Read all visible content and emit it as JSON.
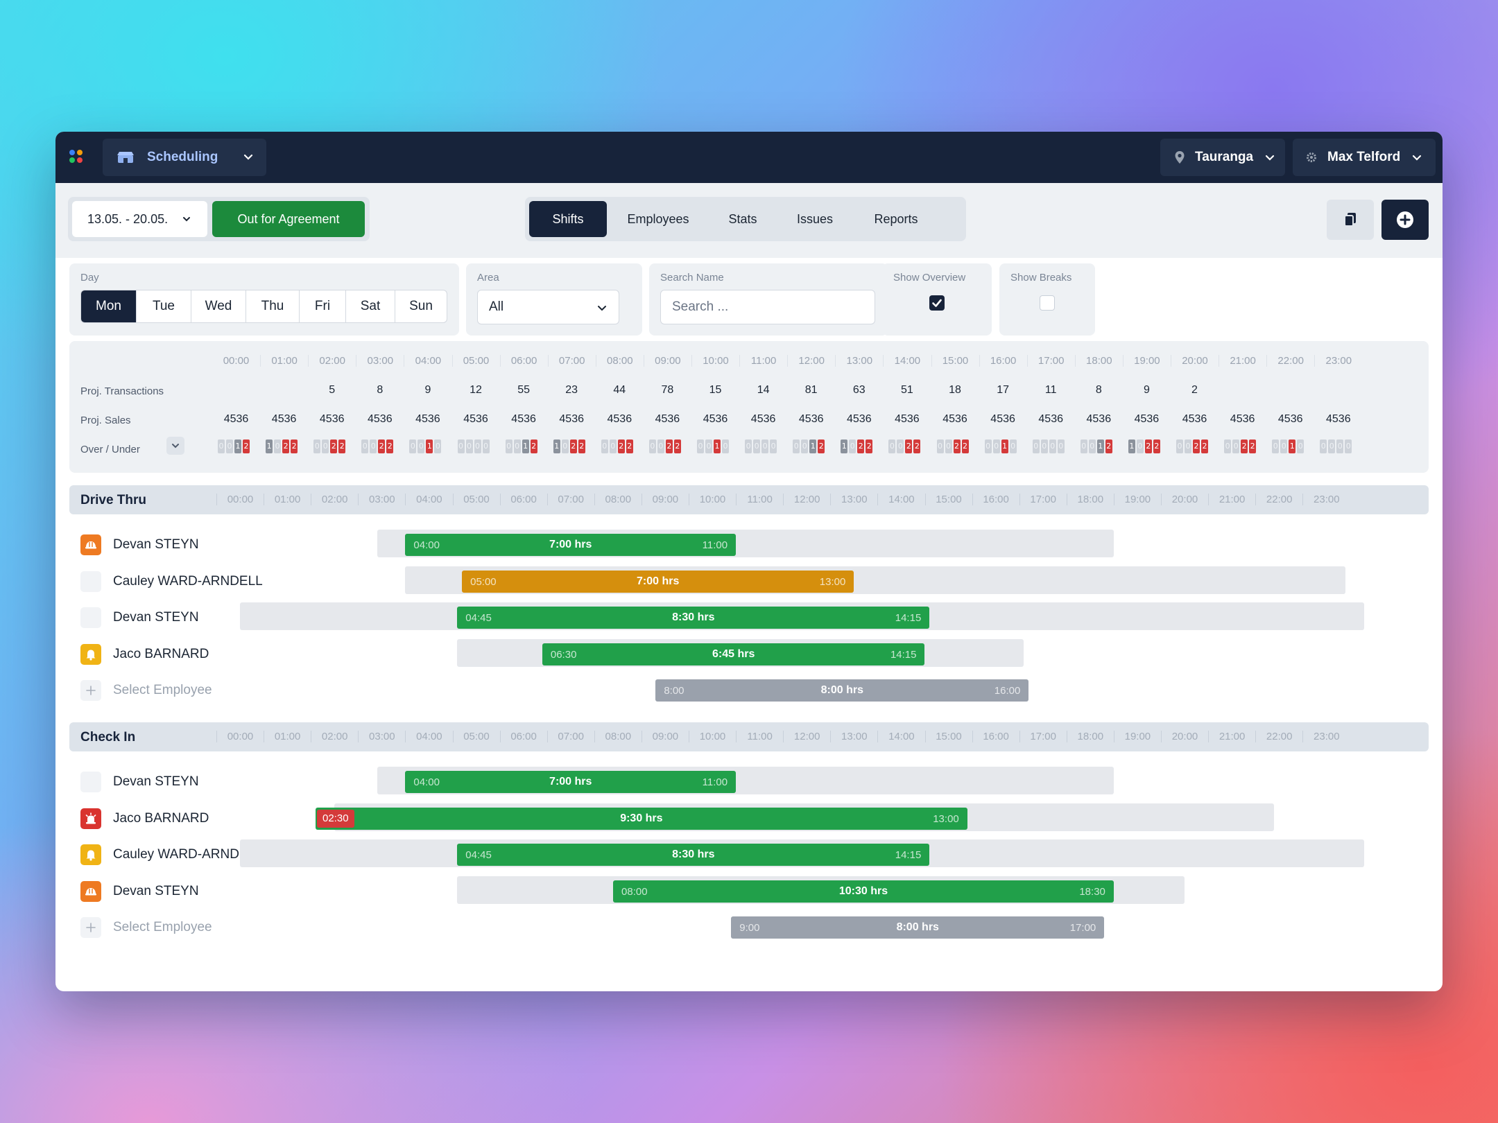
{
  "header": {
    "app_name": "Scheduling",
    "location": "Tauranga",
    "user": "Max Telford"
  },
  "toolbar": {
    "date_range": "13.05. - 20.05.",
    "status_button": "Out for Agreement",
    "tabs": [
      "Shifts",
      "Employees",
      "Stats",
      "Issues",
      "Reports"
    ],
    "active_tab": "Shifts"
  },
  "filters": {
    "day_label": "Day",
    "days": [
      "Mon",
      "Tue",
      "Wed",
      "Thu",
      "Fri",
      "Sat",
      "Sun"
    ],
    "active_day": "Mon",
    "area_label": "Area",
    "area_value": "All",
    "search_label": "Search Name",
    "search_placeholder": "Search ...",
    "overview_label": "Show Overview",
    "overview_checked": true,
    "breaks_label": "Show Breaks",
    "breaks_checked": false
  },
  "hours": [
    "00:00",
    "01:00",
    "02:00",
    "03:00",
    "04:00",
    "05:00",
    "06:00",
    "07:00",
    "08:00",
    "09:00",
    "10:00",
    "11:00",
    "12:00",
    "13:00",
    "14:00",
    "15:00",
    "16:00",
    "17:00",
    "18:00",
    "19:00",
    "20:00",
    "21:00",
    "22:00",
    "23:00"
  ],
  "projections": {
    "transactions_label": "Proj. Transactions",
    "sales_label": "Proj. Sales",
    "over_under_label": "Over / Under",
    "transactions": [
      "",
      "",
      "5",
      "8",
      "9",
      "12",
      "55",
      "23",
      "44",
      "78",
      "15",
      "14",
      "81",
      "63",
      "51",
      "18",
      "17",
      "11",
      "8",
      "9",
      "2",
      "",
      "",
      ""
    ],
    "sales": [
      "4536",
      "4536",
      "4536",
      "4536",
      "4536",
      "4536",
      "4536",
      "4536",
      "4536",
      "4536",
      "4536",
      "4536",
      "4536",
      "4536",
      "4536",
      "4536",
      "4536",
      "4536",
      "4536",
      "4536",
      "4536",
      "4536",
      "4536",
      "4536"
    ],
    "over_under": [
      [
        "0",
        "0",
        "1",
        "2"
      ],
      [
        "1",
        "0",
        "2",
        "2"
      ],
      [
        "0",
        "0",
        "2",
        "2"
      ],
      [
        "0",
        "0",
        "2",
        "2"
      ],
      [
        "0",
        "0",
        "1",
        "0"
      ],
      [
        "0",
        "0",
        "0",
        "0"
      ],
      [
        "0",
        "0",
        "1",
        "2"
      ],
      [
        "1",
        "0",
        "2",
        "2"
      ],
      [
        "0",
        "0",
        "2",
        "2"
      ],
      [
        "0",
        "0",
        "2",
        "2"
      ],
      [
        "0",
        "0",
        "1",
        "0"
      ],
      [
        "0",
        "0",
        "0",
        "0"
      ],
      [
        "0",
        "0",
        "1",
        "2"
      ],
      [
        "1",
        "0",
        "2",
        "2"
      ],
      [
        "0",
        "0",
        "2",
        "2"
      ],
      [
        "0",
        "0",
        "2",
        "2"
      ],
      [
        "0",
        "0",
        "1",
        "0"
      ],
      [
        "0",
        "0",
        "0",
        "0"
      ],
      [
        "0",
        "0",
        "1",
        "2"
      ],
      [
        "1",
        "0",
        "2",
        "2"
      ],
      [
        "0",
        "0",
        "2",
        "2"
      ],
      [
        "0",
        "0",
        "2",
        "2"
      ],
      [
        "0",
        "0",
        "1",
        "0"
      ],
      [
        "0",
        "0",
        "0",
        "0"
      ]
    ]
  },
  "sections": [
    {
      "title": "Drive Thru",
      "rows": [
        {
          "name": "Devan STEYN",
          "avatar": "orange-helmet-icon",
          "start": "04:00",
          "end": "11:00",
          "duration": "7:00 hrs",
          "color": "green",
          "shift_start_h": 4,
          "shift_end_h": 11,
          "avail_start_h": 3.4,
          "avail_end_h": 19
        },
        {
          "name": "Cauley WARD-ARNDELL",
          "avatar": "blank",
          "start": "05:00",
          "end": "13:00",
          "duration": "7:00 hrs",
          "color": "orange",
          "shift_start_h": 5.2,
          "shift_end_h": 13.5,
          "avail_start_h": 4,
          "avail_end_h": 23.9
        },
        {
          "name": "Devan STEYN",
          "avatar": "blank",
          "start": "04:45",
          "end": "14:15",
          "duration": "8:30 hrs",
          "color": "green",
          "shift_start_h": 5.1,
          "shift_end_h": 15.1,
          "avail_start_h": 0.5,
          "avail_end_h": 24.3
        },
        {
          "name": "Jaco BARNARD",
          "avatar": "yellow-bell-icon",
          "start": "06:30",
          "end": "14:15",
          "duration": "6:45 hrs",
          "color": "green",
          "shift_start_h": 6.9,
          "shift_end_h": 15,
          "avail_start_h": 5.1,
          "avail_end_h": 17.1
        },
        {
          "name": "Select Employee",
          "placeholder": true,
          "start": "8:00",
          "end": "16:00",
          "duration": "8:00 hrs",
          "color": "gray",
          "shift_start_h": 9.3,
          "shift_end_h": 17.2
        }
      ]
    },
    {
      "title": "Check In",
      "rows": [
        {
          "name": "Devan STEYN",
          "avatar": "blank",
          "start": "04:00",
          "end": "11:00",
          "duration": "7:00 hrs",
          "color": "green",
          "shift_start_h": 4,
          "shift_end_h": 11,
          "avail_start_h": 3.4,
          "avail_end_h": 19
        },
        {
          "name": "Jaco BARNARD",
          "avatar": "red-alarm-icon",
          "start": "02:30",
          "end": "13:00",
          "duration": "9:30 hrs",
          "color": "green",
          "start_flag": "red",
          "shift_start_h": 2.1,
          "shift_end_h": 15.9,
          "avail_start_h": 2.5,
          "avail_end_h": 22.4
        },
        {
          "name": "Cauley WARD-ARNDELL",
          "avatar": "yellow-bell-icon",
          "start": "04:45",
          "end": "14:15",
          "duration": "8:30 hrs",
          "color": "green",
          "shift_start_h": 5.1,
          "shift_end_h": 15.1,
          "avail_start_h": 0.5,
          "avail_end_h": 24.3
        },
        {
          "name": "Devan STEYN",
          "avatar": "orange-helmet-icon",
          "start": "08:00",
          "end": "18:30",
          "duration": "10:30 hrs",
          "color": "green",
          "shift_start_h": 8.4,
          "shift_end_h": 19,
          "avail_start_h": 5.1,
          "avail_end_h": 20.5
        },
        {
          "name": "Select Employee",
          "placeholder": true,
          "start": "9:00",
          "end": "17:00",
          "duration": "8:00 hrs",
          "color": "gray",
          "shift_start_h": 10.9,
          "shift_end_h": 18.8
        }
      ]
    }
  ],
  "colors": {
    "nav_bg": "#17233a",
    "green": "#21a04a",
    "orange": "#d58f0d",
    "gray": "#9aa1ac",
    "red": "#d43a3a",
    "agree_green": "#1c8a3c"
  }
}
